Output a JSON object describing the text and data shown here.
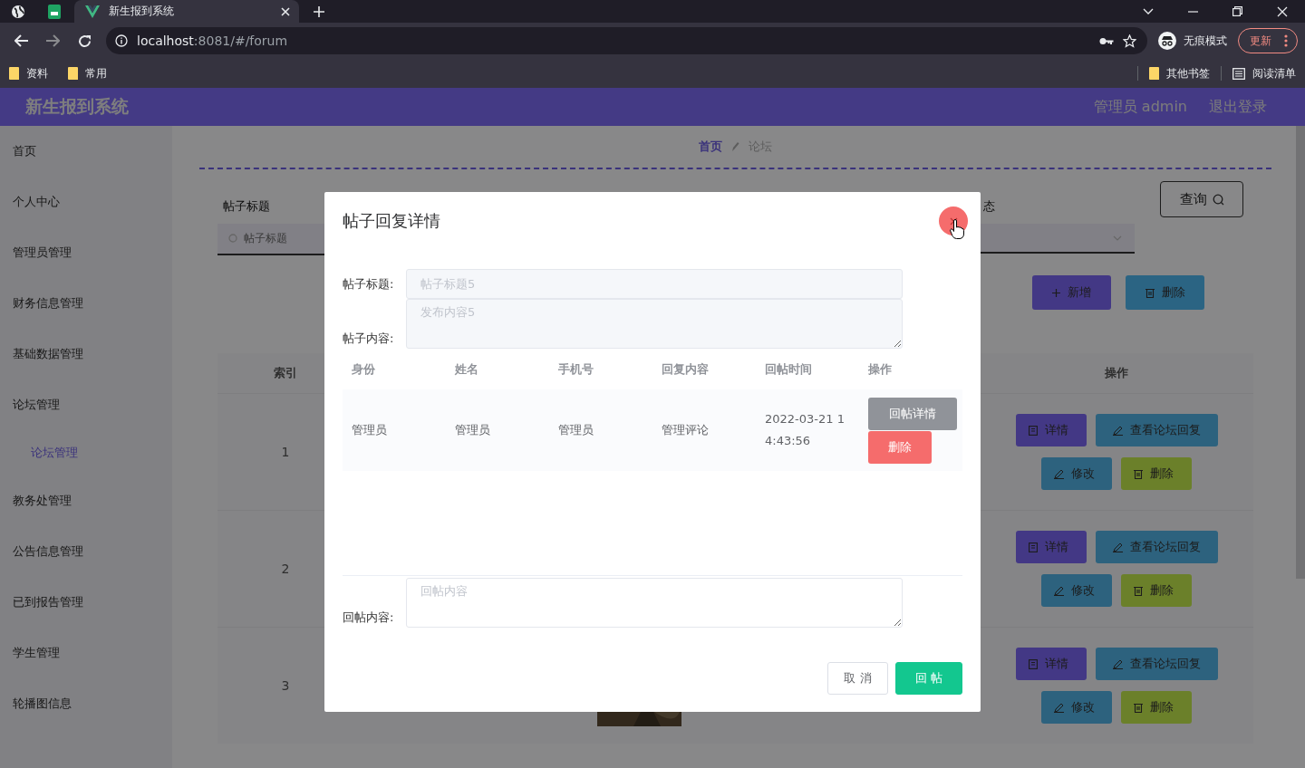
{
  "browser": {
    "tabs": [
      {
        "kind": "globe",
        "selected": false
      },
      {
        "kind": "sheet",
        "selected": false
      },
      {
        "kind": "page",
        "title": "新生报到系统",
        "selected": true
      }
    ],
    "address": {
      "host": "localhost",
      "rest": ":8081/#/forum"
    },
    "profile": "无痕模式",
    "update": "更新",
    "bookmarks": [
      {
        "kind": "folder",
        "label": "资料"
      },
      {
        "kind": "folder",
        "label": "常用"
      }
    ],
    "bookmarks_right": [
      {
        "kind": "folder",
        "label": "其他书签"
      },
      {
        "kind": "list",
        "label": "阅读清单"
      }
    ]
  },
  "header": {
    "title": "新生报到系统",
    "user": "管理员 admin",
    "logout": "退出登录"
  },
  "sidebar": [
    {
      "label": "首页",
      "selected": false
    },
    {
      "label": "个人中心",
      "selected": false
    },
    {
      "label": "管理员管理",
      "selected": false
    },
    {
      "label": "财务信息管理",
      "selected": false
    },
    {
      "label": "基础数据管理",
      "selected": false
    },
    {
      "label": "论坛管理",
      "selected": false,
      "children": [
        {
          "label": "论坛管理",
          "selected": true
        }
      ]
    },
    {
      "label": "教务处管理",
      "selected": false
    },
    {
      "label": "公告信息管理",
      "selected": false
    },
    {
      "label": "已到报告管理",
      "selected": false
    },
    {
      "label": "学生管理",
      "selected": false
    },
    {
      "label": "轮播图信息",
      "selected": false
    }
  ],
  "breadcrumb": [
    "首页",
    "论坛"
  ],
  "filters": {
    "title_label": "帖子标题",
    "title_placeholder": "帖子标题",
    "status_label": "态",
    "search": "查询"
  },
  "actions": [
    {
      "kind": "add",
      "label": "新增"
    },
    {
      "kind": "delete",
      "label": "删除"
    }
  ],
  "table": {
    "columns": [
      "索引",
      "操作"
    ],
    "rows": [
      {
        "index": "1",
        "actions": [
          "详情",
          "查看论坛回复",
          "修改",
          "删除"
        ]
      },
      {
        "index": "2",
        "actions": [
          "详情",
          "查看论坛回复",
          "修改",
          "删除"
        ]
      },
      {
        "index": "3",
        "image": {
          "kind": "picture"
        },
        "actions": [
          "详情",
          "查看论坛回复",
          "修改",
          "删除"
        ]
      }
    ]
  },
  "dialog": {
    "title": "帖子回复详情",
    "fields": [
      {
        "kind": "input",
        "label": "帖子标题:",
        "placeholder": "帖子标题5"
      },
      {
        "kind": "textarea",
        "label": "帖子内容:",
        "placeholder": "发布内容5"
      }
    ],
    "columns": [
      "身份",
      "姓名",
      "手机号",
      "回复内容",
      "回帖时间",
      "操作"
    ],
    "rows": [
      {
        "cells": [
          "管理员",
          "管理员",
          "管理员",
          "管理评论",
          "2022-03-21 14:43:56"
        ],
        "actions": [
          {
            "kind": "detail",
            "label": "回帖详情"
          },
          {
            "kind": "delete",
            "label": "删除"
          }
        ]
      }
    ],
    "reply": {
      "label": "回帖内容:",
      "placeholder": "回帖内容"
    },
    "buttons": [
      {
        "kind": "cancel",
        "label": "取 消"
      },
      {
        "kind": "submit",
        "label": "回 帖"
      }
    ]
  }
}
